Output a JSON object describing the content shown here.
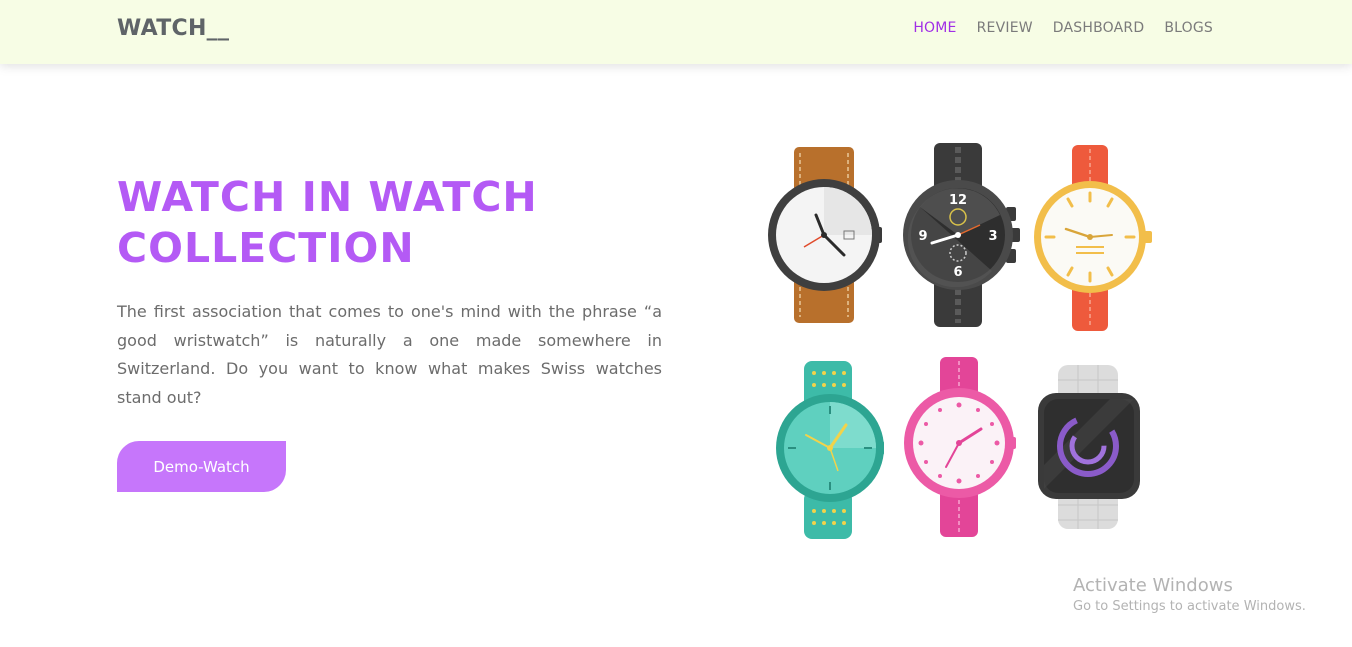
{
  "navbar": {
    "brand": "WATCH__",
    "links": [
      {
        "label": "HOME",
        "active": true
      },
      {
        "label": "REVIEW",
        "active": false
      },
      {
        "label": "DASHBOARD",
        "active": false
      },
      {
        "label": "BLOGS",
        "active": false
      }
    ]
  },
  "hero": {
    "title_line1": "WATCH IN WATCH",
    "title_line2": "COLLECTION",
    "description": "The first association that comes to one's mind with the phrase “a good wristwatch” is naturally a one made somewhere in Switzerland. Do you want to know what makes Swiss watches stand out?",
    "button_label": "Demo-Watch"
  },
  "watch_illustration": {
    "watches": [
      {
        "name": "brown-leather-watch",
        "strap": "#b8702c",
        "case": "#444444",
        "face": "#f2f2f2"
      },
      {
        "name": "black-chrono-watch",
        "strap": "#3a3a3a",
        "case": "#4a4a4a",
        "face": "#2e2e2e",
        "numerals": [
          "12",
          "3",
          "6",
          "9"
        ]
      },
      {
        "name": "gold-red-watch",
        "strap": "#ee5a3c",
        "case": "#f2be4a",
        "face": "#fbfaf5"
      },
      {
        "name": "teal-watch",
        "strap": "#3dbba8",
        "case": "#2da592",
        "face": "#5fd0bf"
      },
      {
        "name": "pink-watch",
        "strap": "#e34598",
        "case": "#ec5aa6",
        "face": "#fbf2f7"
      },
      {
        "name": "smartwatch",
        "strap": "#dcdcdc",
        "case": "#3a3a3a",
        "face": "#2f2f2f",
        "ring": "#8a5bc9"
      }
    ]
  },
  "system_overlay": {
    "title": "Activate Windows",
    "subtitle": "Go to Settings to activate Windows."
  },
  "colors": {
    "navbar_bg": "#f7fde5",
    "accent": "#b45af5",
    "active_link": "#a12ee6",
    "button_bg": "#c676fb",
    "body_text": "#6c6c6c"
  }
}
